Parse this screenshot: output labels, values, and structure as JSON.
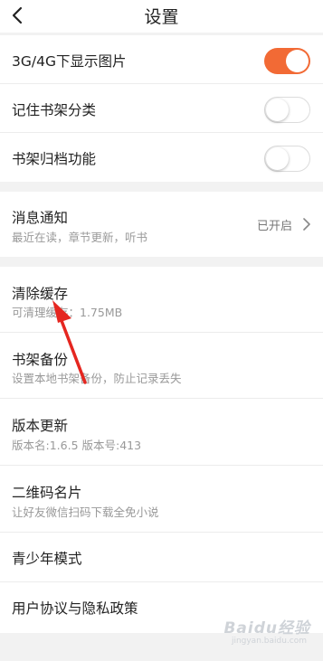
{
  "header": {
    "title": "设置"
  },
  "group1": {
    "items": [
      {
        "label": "3G/4G下显示图片",
        "toggle": "on"
      },
      {
        "label": "记住书架分类",
        "toggle": "off"
      },
      {
        "label": "书架归档功能",
        "toggle": "off"
      }
    ]
  },
  "notification": {
    "label": "消息通知",
    "sub": "最近在读，章节更新，听书",
    "status": "已开启"
  },
  "group3": {
    "items": [
      {
        "label": "清除缓存",
        "sub": "可清理缓存：1.75MB"
      },
      {
        "label": "书架备份",
        "sub": "设置本地书架备份，防止记录丢失"
      },
      {
        "label": "版本更新",
        "sub": "版本名:1.6.5  版本号:413"
      },
      {
        "label": "二维码名片",
        "sub": "让好友微信扫码下载全免小说"
      },
      {
        "label": "青少年模式"
      },
      {
        "label": "用户协议与隐私政策"
      }
    ]
  },
  "watermark": {
    "text": "Baidu经验",
    "url": "jingyan.baidu.com"
  },
  "colors": {
    "accent": "#f26a35",
    "annotation": "#e52620"
  }
}
